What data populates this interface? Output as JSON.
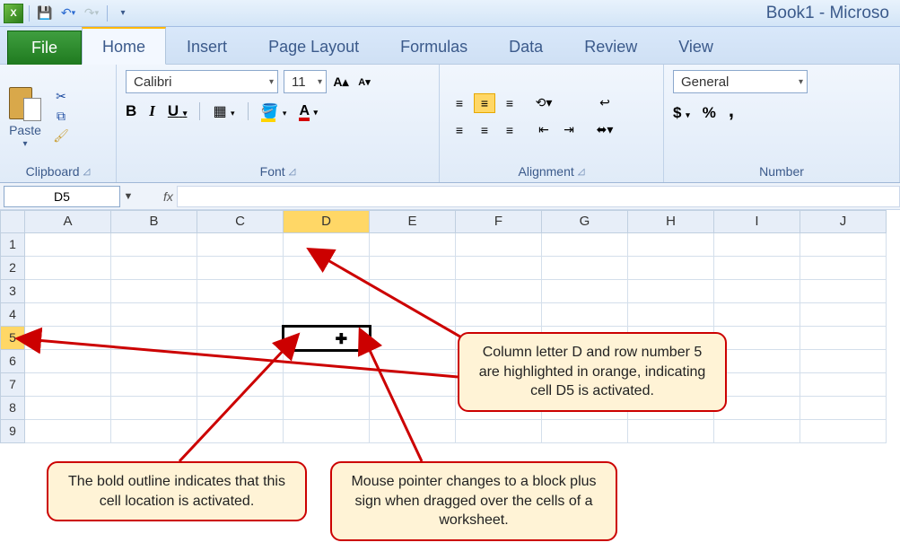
{
  "title": "Book1 - Microso",
  "tabs": {
    "file": "File",
    "home": "Home",
    "insert": "Insert",
    "pagelayout": "Page Layout",
    "formulas": "Formulas",
    "data": "Data",
    "review": "Review",
    "view": "View"
  },
  "clipboard": {
    "paste": "Paste",
    "label": "Clipboard"
  },
  "font": {
    "name": "Calibri",
    "size": "11",
    "label": "Font",
    "bold": "B",
    "italic": "I",
    "underline": "U"
  },
  "alignment": {
    "label": "Alignment"
  },
  "number": {
    "format": "General",
    "label": "Number",
    "currency": "$",
    "percent": "%",
    "comma": ","
  },
  "namebox": "D5",
  "fx": "fx",
  "columns": [
    "A",
    "B",
    "C",
    "D",
    "E",
    "F",
    "G",
    "H",
    "I",
    "J"
  ],
  "rows": [
    "1",
    "2",
    "3",
    "4",
    "5",
    "6",
    "7",
    "8",
    "9"
  ],
  "active": {
    "col": "D",
    "row": "5"
  },
  "callouts": {
    "c1": "Column letter D and row number 5 are highlighted in orange, indicating cell D5 is activated.",
    "c2": "The bold outline indicates that this cell location is activated.",
    "c3": "Mouse pointer changes to a block plus sign when dragged over the cells of a worksheet."
  }
}
